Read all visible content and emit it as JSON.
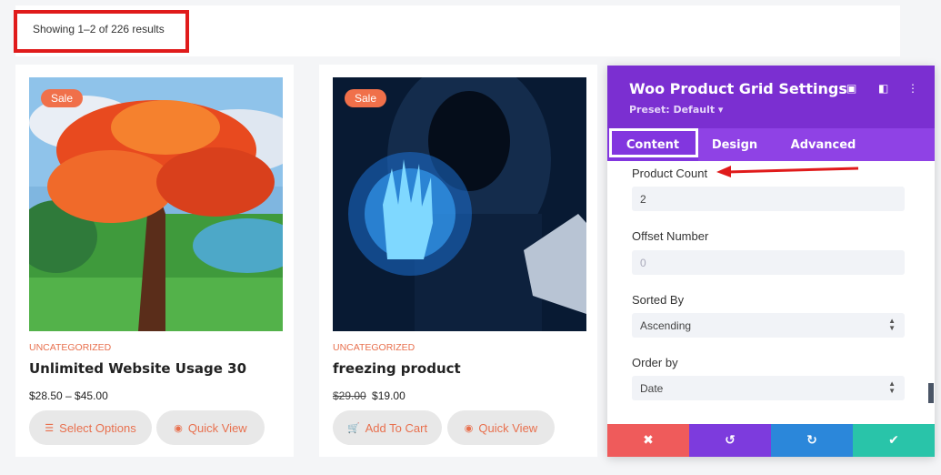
{
  "results": {
    "text": "Showing 1–2 of 226 results"
  },
  "products": [
    {
      "badge": "Sale",
      "category": "UNCATEGORIZED",
      "title": "Unlimited Website Usage 30",
      "price_old": "",
      "price": "$28.50 – $45.00",
      "buttons": [
        {
          "label": "Select Options",
          "icon": "list-icon"
        },
        {
          "label": "Quick View",
          "icon": "eye-icon"
        }
      ]
    },
    {
      "badge": "Sale",
      "category": "UNCATEGORIZED",
      "title": "freezing product",
      "price_old": "$29.00",
      "price": "$19.00",
      "buttons": [
        {
          "label": "Add To Cart",
          "icon": "cart-icon"
        },
        {
          "label": "Quick View",
          "icon": "eye-icon"
        }
      ]
    }
  ],
  "panel": {
    "title": "Woo Product Grid Settings",
    "preset": "Preset: Default ▾",
    "tabs": [
      "Content",
      "Design",
      "Advanced"
    ],
    "active_tab": "Content",
    "fields": {
      "product_count_label": "Product Count",
      "product_count_value": "2",
      "offset_label": "Offset Number",
      "offset_placeholder": "0",
      "sorted_by_label": "Sorted By",
      "sorted_by_value": "Ascending",
      "order_by_label": "Order by",
      "order_by_value": "Date"
    },
    "footer": {
      "cancel": "✖",
      "undo": "↺",
      "redo": "↻",
      "save": "✔"
    }
  },
  "colors": {
    "accent_purple": "#7b2fd1",
    "sale_orange": "#f0704a",
    "annotation_red": "#e01b1b"
  }
}
